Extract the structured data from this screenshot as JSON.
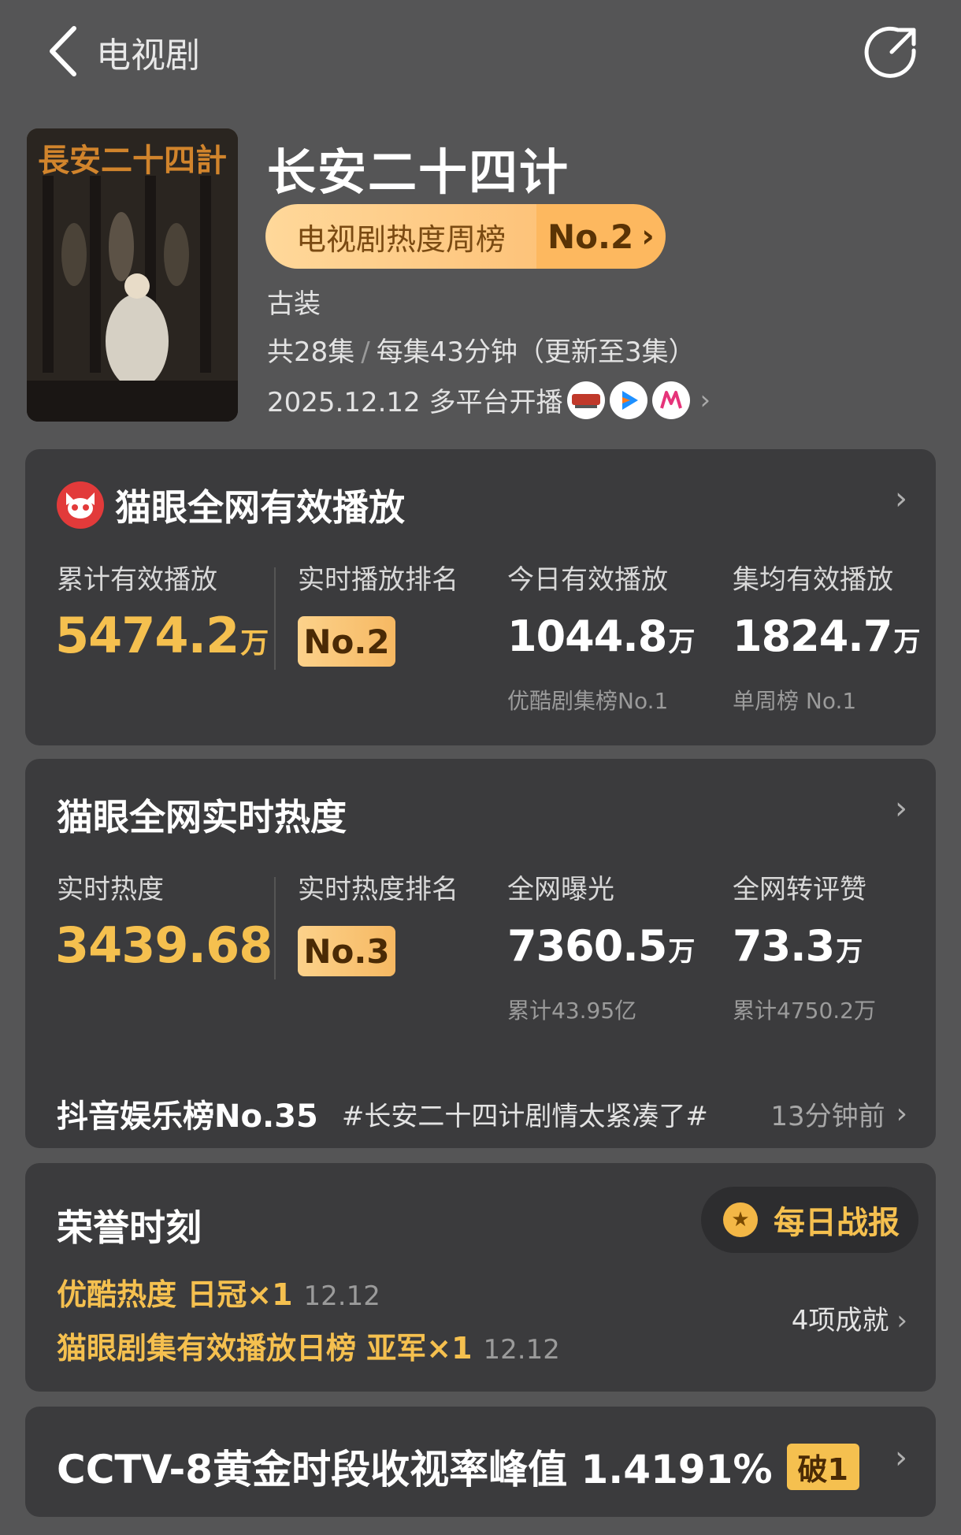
{
  "header": {
    "back_icon": "chevron-left-icon",
    "title": "电视剧",
    "share_icon": "share-icon"
  },
  "drama": {
    "poster_title": "長安二十四計",
    "title": "长安二十四计",
    "rank_label": "电视剧热度周榜",
    "rank_value": "No.2",
    "genre": "古装",
    "episodes": "共28集",
    "episode_sep": "/",
    "episode_detail": "每集43分钟（更新至3集）",
    "release": "2025.12.12 多平台开播",
    "platforms": [
      "cctv8-icon",
      "youku-icon",
      "mgtv-icon"
    ]
  },
  "playback": {
    "title": "猫眼全网有效播放",
    "cumulative_label": "累计有效播放",
    "cumulative_value": "5474.2",
    "cumulative_unit": "万",
    "realtime_rank_label": "实时播放排名",
    "realtime_rank": "No.2",
    "today_label": "今日有效播放",
    "today_value": "1044.8",
    "today_unit": "万",
    "today_sub": "优酷剧集榜No.1",
    "avg_label": "集均有效播放",
    "avg_value": "1824.7",
    "avg_unit": "万",
    "avg_sub": "单周榜 No.1"
  },
  "heat": {
    "title": "猫眼全网实时热度",
    "heat_label": "实时热度",
    "heat_value": "3439.68",
    "heat_rank_label": "实时热度排名",
    "heat_rank": "No.3",
    "exposure_label": "全网曝光",
    "exposure_value": "7360.5",
    "exposure_unit": "万",
    "exposure_sub": "累计43.95亿",
    "engage_label": "全网转评赞",
    "engage_value": "73.3",
    "engage_unit": "万",
    "engage_sub": "累计4750.2万",
    "douyin_rank": "抖音娱乐榜No.35",
    "douyin_topic": "#长安二十四计剧情太紧凑了#",
    "douyin_time": "13分钟前"
  },
  "honor": {
    "title": "荣誉时刻",
    "daily_label": "每日战报",
    "items": [
      {
        "text": "优酷热度 日冠×1",
        "date": "12.12"
      },
      {
        "text": "猫眼剧集有效播放日榜 亚军×1",
        "date": "12.12"
      }
    ],
    "achievements": "4项成就"
  },
  "ratings": {
    "text": "CCTV-8黄金时段收视率峰值 1.4191%",
    "badge": "破1"
  },
  "colors": {
    "accent": "#f5c04f",
    "background": "#555556",
    "card": "#3b3b3d"
  }
}
